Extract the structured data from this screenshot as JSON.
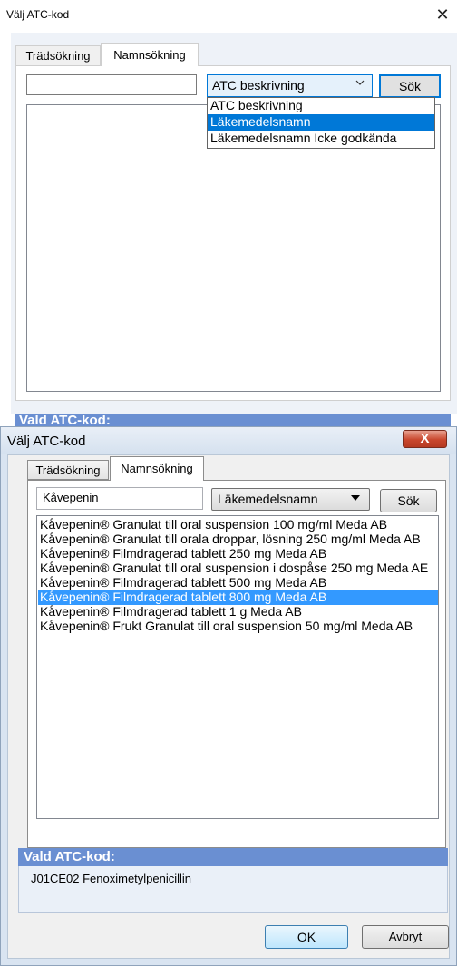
{
  "window1": {
    "title": "Välj ATC-kod",
    "close_glyph": "✕",
    "tabs": [
      {
        "label": "Trädsökning"
      },
      {
        "label": "Namnsökning"
      }
    ],
    "search_input_value": "",
    "select_value": "ATC beskrivning",
    "search_button_label": "Sök",
    "dropdown_options": [
      {
        "label": "ATC beskrivning",
        "selected": false
      },
      {
        "label": "Läkemedelsnamn",
        "selected": true
      },
      {
        "label": "Läkemedelsnamn Icke godkända",
        "selected": false
      }
    ],
    "vald_label": "Vald ATC-kod:"
  },
  "window2": {
    "title": "Välj ATC-kod",
    "close_glyph": "X",
    "tabs": [
      {
        "label": "Trädsökning"
      },
      {
        "label": "Namnsökning"
      }
    ],
    "search_input_value": "Kåvepenin",
    "select_value": "Läkemedelsnamn",
    "search_button_label": "Sök",
    "results": [
      "Kåvepenin® Granulat till oral suspension 100 mg/ml Meda AB",
      "Kåvepenin® Granulat till orala droppar, lösning 250 mg/ml Meda AB",
      "Kåvepenin® Filmdragerad tablett 250 mg Meda AB",
      "Kåvepenin® Granulat till oral suspension i dospåse 250 mg Meda AE",
      "Kåvepenin® Filmdragerad tablett 500 mg Meda AB",
      "Kåvepenin® Filmdragerad tablett 800 mg Meda AB",
      "Kåvepenin® Filmdragerad tablett 1 g Meda AB",
      "Kåvepenin® Frukt Granulat till oral suspension 50 mg/ml Meda AB"
    ],
    "selected_index": 5,
    "vald_label": "Vald ATC-kod:",
    "vald_value": "J01CE02 Fenoximetylpenicillin",
    "ok_label": "OK",
    "cancel_label": "Avbryt"
  },
  "colors": {
    "selection": "#3399ff",
    "header_blue": "#6a8fd2",
    "win10_selection": "#0078d7"
  }
}
